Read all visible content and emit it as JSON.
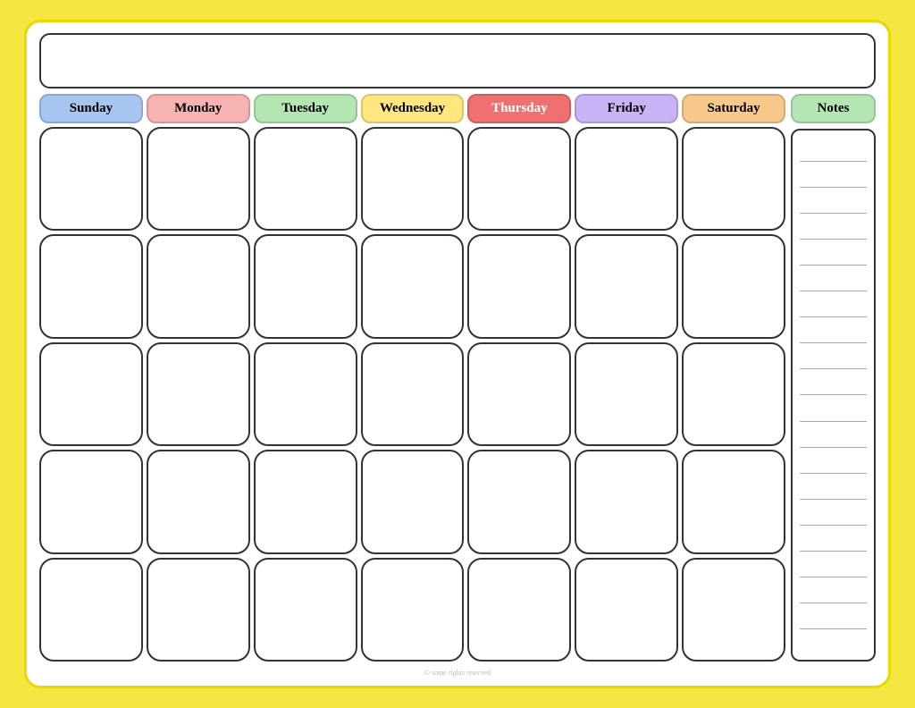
{
  "calendar": {
    "title": "",
    "days": [
      {
        "label": "Sunday",
        "class": "sunday"
      },
      {
        "label": "Monday",
        "class": "monday"
      },
      {
        "label": "Tuesday",
        "class": "tuesday"
      },
      {
        "label": "Wednesday",
        "class": "wednesday"
      },
      {
        "label": "Thursday",
        "class": "thursday"
      },
      {
        "label": "Friday",
        "class": "friday"
      },
      {
        "label": "Saturday",
        "class": "saturday"
      }
    ],
    "weeks": 5,
    "notes_label": "Notes",
    "watermark": "© some rights reserved"
  }
}
